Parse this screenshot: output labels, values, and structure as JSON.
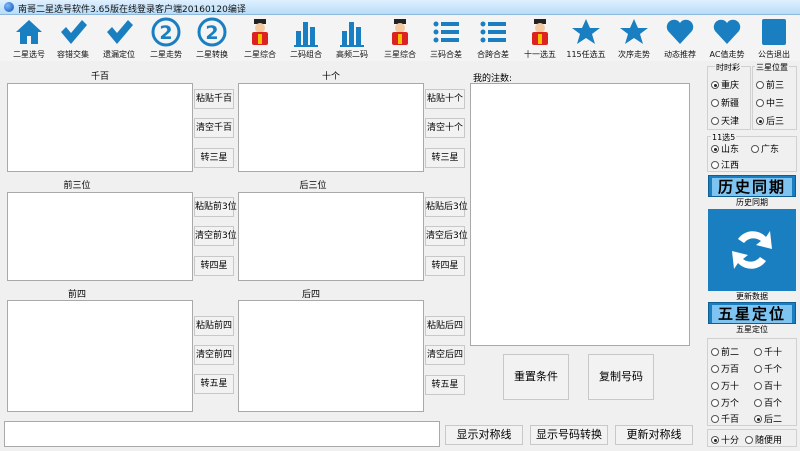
{
  "window": {
    "title": "南哥二星选号软件3.65版在线登录客户端20160120编译"
  },
  "toolbar": [
    {
      "label": "二星选号",
      "icon": "home-icon"
    },
    {
      "label": "容错交集",
      "icon": "check-icon"
    },
    {
      "label": "遗漏定位",
      "icon": "check-icon"
    },
    {
      "label": "二星走势",
      "icon": "number-2-icon"
    },
    {
      "label": "二星转换",
      "icon": "number-2-icon"
    },
    {
      "label": "二星综合",
      "icon": "god-figure-icon"
    },
    {
      "label": "二码组合",
      "icon": "bar-chart-icon"
    },
    {
      "label": "高频二码",
      "icon": "bar-chart-icon"
    },
    {
      "label": "三星综合",
      "icon": "god-figure-icon"
    },
    {
      "label": "三码合差",
      "icon": "list-icon"
    },
    {
      "label": "合跨合差",
      "icon": "list-icon"
    },
    {
      "label": "十一选五",
      "icon": "god-figure-icon"
    },
    {
      "label": "115任选五",
      "icon": "star-icon"
    },
    {
      "label": "次序走势",
      "icon": "star-icon"
    },
    {
      "label": "动态推荐",
      "icon": "heart-icon"
    },
    {
      "label": "AC值走势",
      "icon": "heart-icon"
    },
    {
      "label": "公告退出",
      "icon": "square-icon"
    }
  ],
  "sections": {
    "qianbai": {
      "caption": "千百",
      "paste": "粘贴千百",
      "clear": "清空千百",
      "convert": "转三星"
    },
    "shige": {
      "caption": "十个",
      "paste": "粘贴十个",
      "clear": "清空十个",
      "convert": "转三星"
    },
    "qiansan": {
      "caption": "前三位",
      "paste": "粘贴前3位",
      "clear": "清空前3位",
      "convert": "转四星"
    },
    "housan": {
      "caption": "后三位",
      "paste": "粘贴后3位",
      "clear": "清空后3位",
      "convert": "转四星"
    },
    "qiansi": {
      "caption": "前四",
      "paste": "粘贴前四",
      "clear": "清空前四",
      "convert": "转五星"
    },
    "housi": {
      "caption": "后四",
      "paste": "粘贴后四",
      "clear": "清空后四",
      "convert": "转五星"
    }
  },
  "my_bet": {
    "caption": "我的注数:",
    "reset": "重置条件",
    "copy": "复制号码"
  },
  "bottom_buttons": {
    "show_symmetric": "显示对称线",
    "show_convert": "显示号码转换",
    "update_symmetric": "更新对称线"
  },
  "sidebar": {
    "era_group": {
      "caption": "时时彩",
      "options": [
        {
          "label": "重庆",
          "selected": true
        },
        {
          "label": "新疆",
          "selected": false
        },
        {
          "label": "天津",
          "selected": false
        }
      ]
    },
    "position_group": {
      "caption": "三星位置",
      "options": [
        {
          "label": "前三",
          "selected": false
        },
        {
          "label": "中三",
          "selected": false
        },
        {
          "label": "后三",
          "selected": true
        }
      ]
    },
    "eleven_group": {
      "caption": "11选5",
      "options": [
        {
          "label": "山东",
          "selected": true
        },
        {
          "label": "广东",
          "selected": false
        },
        {
          "label": "江西",
          "selected": false
        }
      ]
    },
    "history_banner": "历史同期",
    "history_label": "历史同期",
    "update_label": "更新数据",
    "five_star_banner": "五星定位",
    "five_star_label": "五星定位",
    "five_star_options": [
      {
        "label": "前二",
        "selected": false
      },
      {
        "label": "千十",
        "selected": false
      },
      {
        "label": "万百",
        "selected": false
      },
      {
        "label": "千个",
        "selected": false
      },
      {
        "label": "万十",
        "selected": false
      },
      {
        "label": "百十",
        "selected": false
      },
      {
        "label": "万个",
        "selected": false
      },
      {
        "label": "百个",
        "selected": false
      },
      {
        "label": "千百",
        "selected": false
      },
      {
        "label": "后二",
        "selected": true
      }
    ],
    "bottom_options": [
      {
        "label": "十分",
        "selected": true
      },
      {
        "label": "随便用",
        "selected": false
      }
    ]
  },
  "colors": {
    "icon_blue": "#1a7fc1",
    "banner_blue": "#1a7fc1"
  }
}
